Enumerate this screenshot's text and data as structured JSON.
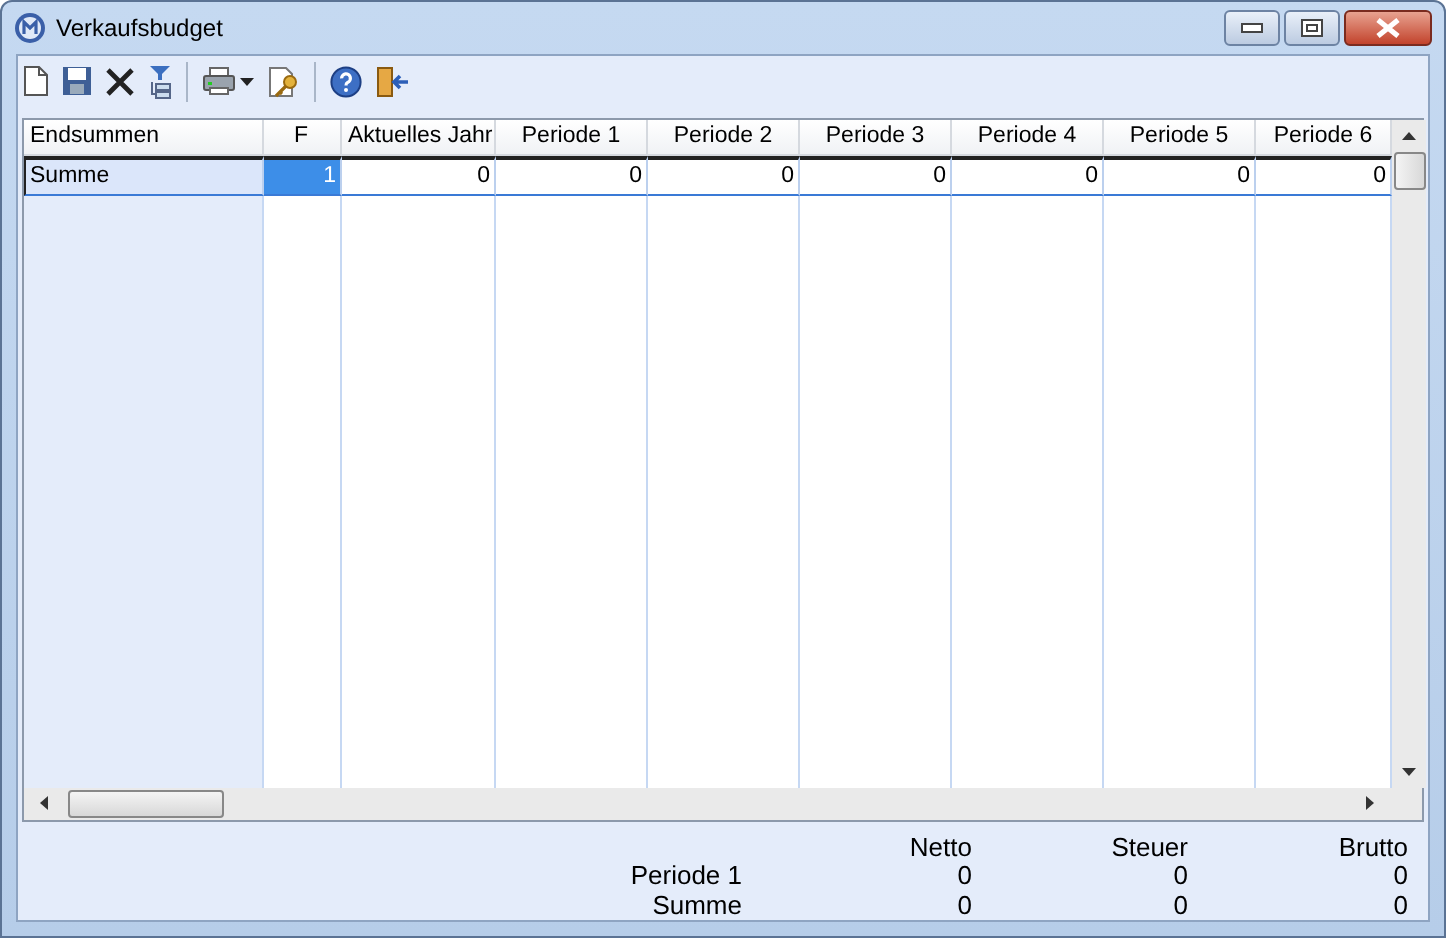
{
  "window": {
    "title": "Verkaufsbudget"
  },
  "table": {
    "columns": [
      "Endsummen",
      "F",
      "Aktuelles Jahr",
      "Periode 1",
      "Periode 2",
      "Periode 3",
      "Periode 4",
      "Periode 5",
      "Periode 6"
    ],
    "rows": [
      {
        "selected": true,
        "cells": [
          {
            "text": "Summe",
            "selected": false
          },
          {
            "text": "1",
            "selected": true
          },
          {
            "text": "0",
            "selected": false
          },
          {
            "text": "0",
            "selected": false
          },
          {
            "text": "0",
            "selected": false
          },
          {
            "text": "0",
            "selected": false
          },
          {
            "text": "0",
            "selected": false
          },
          {
            "text": "0",
            "selected": false
          },
          {
            "text": "0",
            "selected": false
          }
        ]
      }
    ]
  },
  "summary": {
    "columns": [
      "Netto",
      "Steuer",
      "Brutto"
    ],
    "rows": [
      {
        "label": "Periode 1",
        "values": [
          "0",
          "0",
          "0"
        ]
      },
      {
        "label": "Summe",
        "values": [
          "0",
          "0",
          "0"
        ]
      }
    ]
  }
}
